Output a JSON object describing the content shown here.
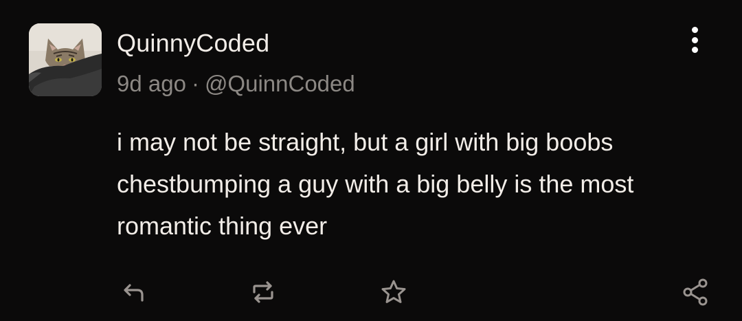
{
  "post": {
    "display_name": "QuinnyCoded",
    "time_ago": "9d ago",
    "separator": "·",
    "handle": "@QuinnCoded",
    "text": "i may not be straight, but a girl with big boobs chestbumping a guy with a big belly is the most romantic thing ever"
  },
  "icons": {
    "more": "more-vertical-icon",
    "reply": "reply-icon",
    "boost": "repeat-icon",
    "favourite": "star-icon",
    "share": "share-icon"
  },
  "colors": {
    "background": "#0b0a0a",
    "primary_text": "#f2ede8",
    "secondary_text": "#8c8884",
    "icon": "#9a9490"
  }
}
